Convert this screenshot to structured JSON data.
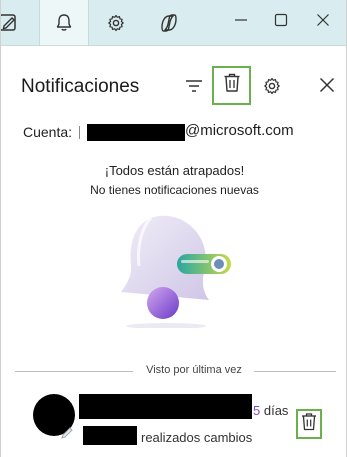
{
  "tabs": [
    {
      "icon": "edit-app-icon"
    },
    {
      "icon": "bell-icon",
      "active": true
    },
    {
      "icon": "gear-icon"
    },
    {
      "icon": "copilot-icon"
    }
  ],
  "window_controls": {
    "minimize": "minimize-icon",
    "maximize": "maximize-icon",
    "close": "close-icon"
  },
  "header": {
    "title": "Notificaciones"
  },
  "account": {
    "label": "Cuenta:",
    "domain": "@microsoft.com"
  },
  "empty_state": {
    "title": "¡Todos están atrapados!",
    "subtitle": "No tienes notificaciones nuevas"
  },
  "divider": {
    "label": "Visto por última vez"
  },
  "notification": {
    "time_number": "5",
    "time_unit": " días",
    "text": "realizados cambios"
  },
  "colors": {
    "highlight": "#6ab04c",
    "tabstrip": "#d9ecef",
    "accent_purple": "#7b52c4"
  }
}
